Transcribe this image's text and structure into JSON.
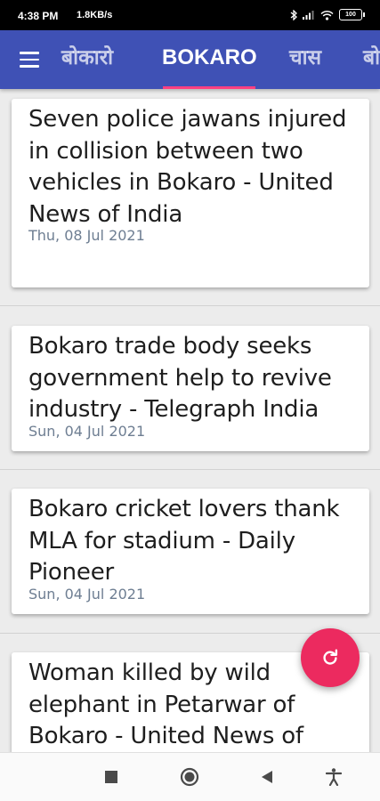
{
  "status_bar": {
    "time": "4:38 PM",
    "network_speed": "1.8KB/s",
    "battery": "100",
    "icons": [
      "bluetooth-icon",
      "signal-icon",
      "wifi-icon",
      "battery-icon"
    ]
  },
  "app_bar": {
    "menu_icon": "hamburger-menu-icon",
    "color": "#3f51b5",
    "indicator_color": "#ff4081",
    "tabs": [
      {
        "label": "बोकारो",
        "active": false
      },
      {
        "label": "BOKARO",
        "active": true
      },
      {
        "label": "चास",
        "active": false
      },
      {
        "label": "बो",
        "active": false
      }
    ]
  },
  "articles": [
    {
      "headline": "Seven police jawans injured in collision between two vehicles in Bokaro - United News of India",
      "date": "Thu, 08 Jul 2021"
    },
    {
      "headline": "Bokaro trade body seeks government help to revive industry - Telegraph India",
      "date": "Sun, 04 Jul 2021"
    },
    {
      "headline": "Bokaro cricket lovers thank MLA for stadium - Daily Pioneer",
      "date": "Sun, 04 Jul 2021"
    },
    {
      "headline": "Woman killed by wild elephant in Petarwar of Bokaro - United News of",
      "date": ""
    }
  ],
  "fab": {
    "icon": "refresh-icon",
    "color": "#ec2a5f"
  },
  "nav_bar": {
    "buttons": [
      "recents-square-icon",
      "home-circle-icon",
      "back-triangle-icon",
      "accessibility-icon"
    ]
  }
}
